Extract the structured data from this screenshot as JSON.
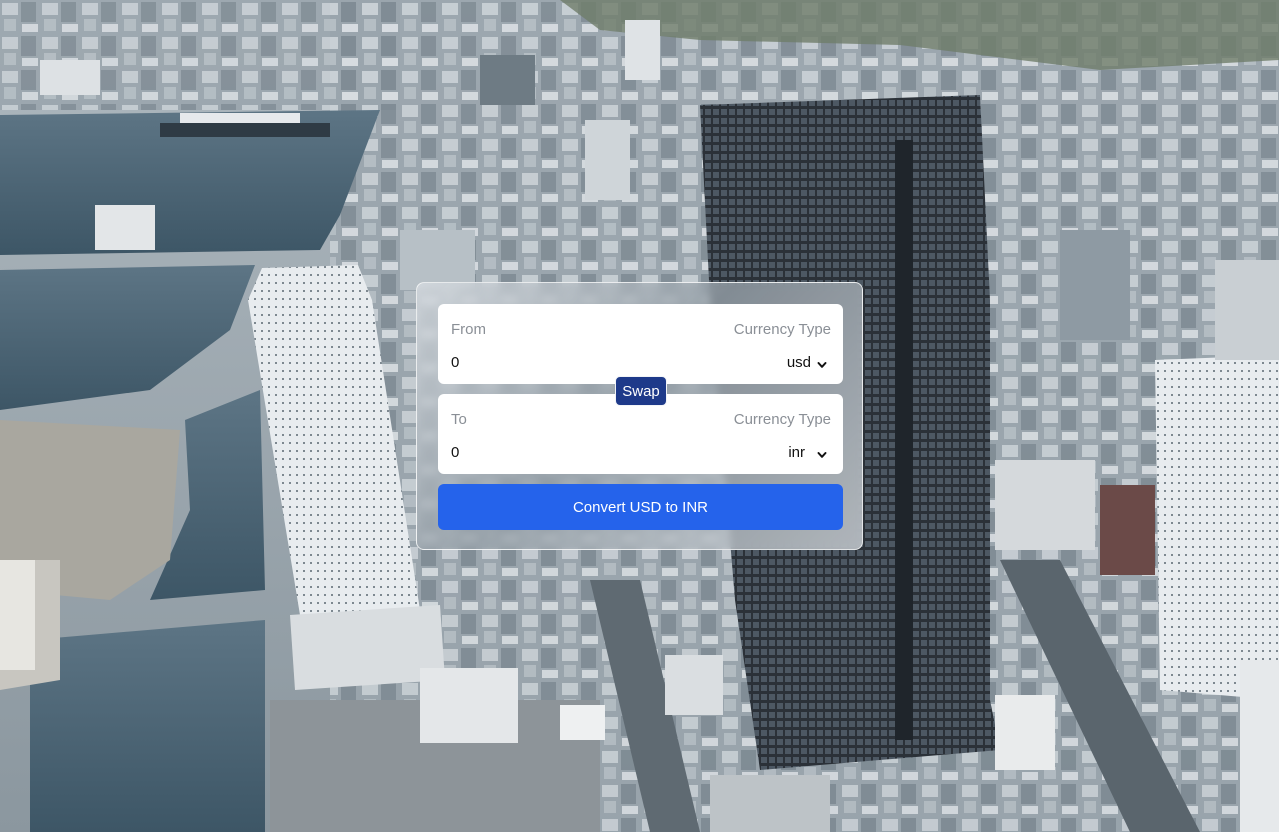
{
  "converter": {
    "from": {
      "label": "From",
      "currency_type_label": "Currency Type",
      "amount": "0",
      "currency": "usd"
    },
    "to": {
      "label": "To",
      "currency_type_label": "Currency Type",
      "amount": "0",
      "currency": "inr"
    },
    "swap_label": "Swap",
    "convert_label": "Convert USD to INR"
  },
  "colors": {
    "swap_button": "#1e3a8a",
    "convert_button": "#2563eb",
    "panel": "#ffffff",
    "muted_text": "#8a8f96"
  },
  "icons": {
    "select_arrow": "chevron-down-icon"
  }
}
